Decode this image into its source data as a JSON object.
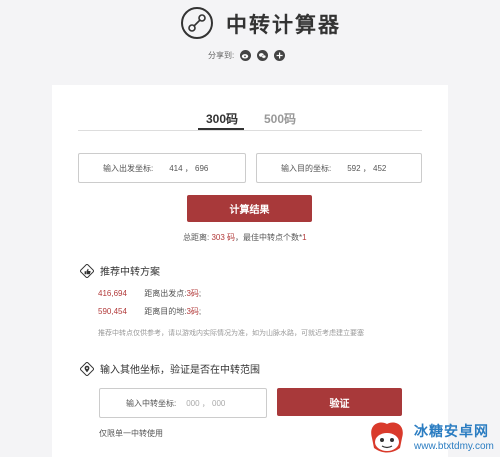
{
  "header": {
    "title": "中转计算器",
    "share_label": "分享到:",
    "share_icons": [
      "weibo-icon",
      "wechat-icon",
      "add-icon"
    ]
  },
  "tabs": [
    {
      "label": "300码",
      "active": true
    },
    {
      "label": "500码",
      "active": false
    }
  ],
  "start_field": {
    "label": "输入出发坐标:",
    "value": "414 ， 696"
  },
  "end_field": {
    "label": "输入目的坐标:",
    "value": "592 ， 452"
  },
  "calc_button": "计算结果",
  "summary": {
    "prefix": "总距离:",
    "distance": "303 码",
    "middle": "，最佳中转点个数*",
    "count": "1"
  },
  "plan": {
    "heading": "推荐中转方案",
    "rows": [
      {
        "coord": "416,694",
        "desc_prefix": "距离出发点:",
        "distance": "3码",
        "suffix": ";"
      },
      {
        "coord": "590,454",
        "desc_prefix": "距离目的地:",
        "distance": "3码",
        "suffix": ";"
      }
    ],
    "note": "推荐中转点仅供参考，请以游戏内实际情况为准，如为山脉水路，可就近考虑建立要塞"
  },
  "verify": {
    "heading": "输入其他坐标，验证是否在中转范围",
    "field_label": "输入中转坐标:",
    "placeholder": "000 ， 000",
    "button": "验证",
    "note": "仅限单一中转使用"
  },
  "watermark": {
    "name": "冰糖安卓网",
    "url": "www.btxtdmy.com"
  },
  "colors": {
    "accent": "#a8393a",
    "accent_text": "#b23a3a",
    "watermark": "#2b7dc2"
  }
}
